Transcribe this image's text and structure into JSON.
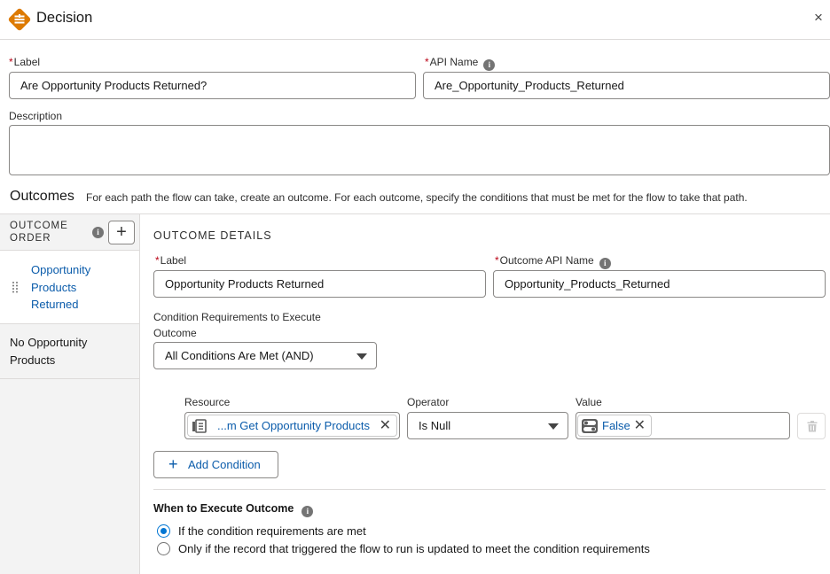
{
  "header": {
    "title": "Decision",
    "close_glyph": "×",
    "logo_icon": "decision-icon",
    "logo_color": "#dd7a01"
  },
  "element": {
    "label_caption": "Label",
    "label_value": "Are Opportunity Products Returned?",
    "api_caption": "API Name",
    "api_value": "Are_Opportunity_Products_Returned",
    "description_caption": "Description",
    "description_value": ""
  },
  "outcomes": {
    "title": "Outcomes",
    "description": "For each path the flow can take, create an outcome. For each outcome, specify the conditions that must be met for the flow to take that path.",
    "order_line1": "OUTCOME",
    "order_line2": "ORDER",
    "add_glyph": "+",
    "items": [
      {
        "line1": "Opportunity",
        "line2": "Products",
        "line3": "Returned"
      },
      {
        "line1": "No Opportunity",
        "line2": "Products"
      }
    ]
  },
  "details": {
    "heading": "OUTCOME DETAILS",
    "label_caption": "Label",
    "label_value": "Opportunity Products Returned",
    "api_caption": "Outcome API Name",
    "api_value": "Opportunity_Products_Returned",
    "req_caption_line1": "Condition Requirements to Execute",
    "req_caption_line2": "Outcome",
    "req_value": "All Conditions Are Met (AND)",
    "condition": {
      "resource_caption": "Resource",
      "resource_value": "...m Get Opportunity Products",
      "operator_caption": "Operator",
      "operator_value": "Is Null",
      "value_caption": "Value",
      "value_value": "False"
    },
    "add_condition_label": "Add Condition",
    "add_condition_glyph": "+",
    "when_heading": "When to Execute Outcome",
    "when_options": [
      {
        "label": "If the condition requirements are met",
        "selected": true
      },
      {
        "label": "Only if the record that triggered the flow to run is updated to meet the condition requirements",
        "selected": false
      }
    ]
  },
  "colors": {
    "link_blue": "#0b5cab",
    "brand_blue": "#0176d3",
    "required_red": "#ba0517"
  }
}
